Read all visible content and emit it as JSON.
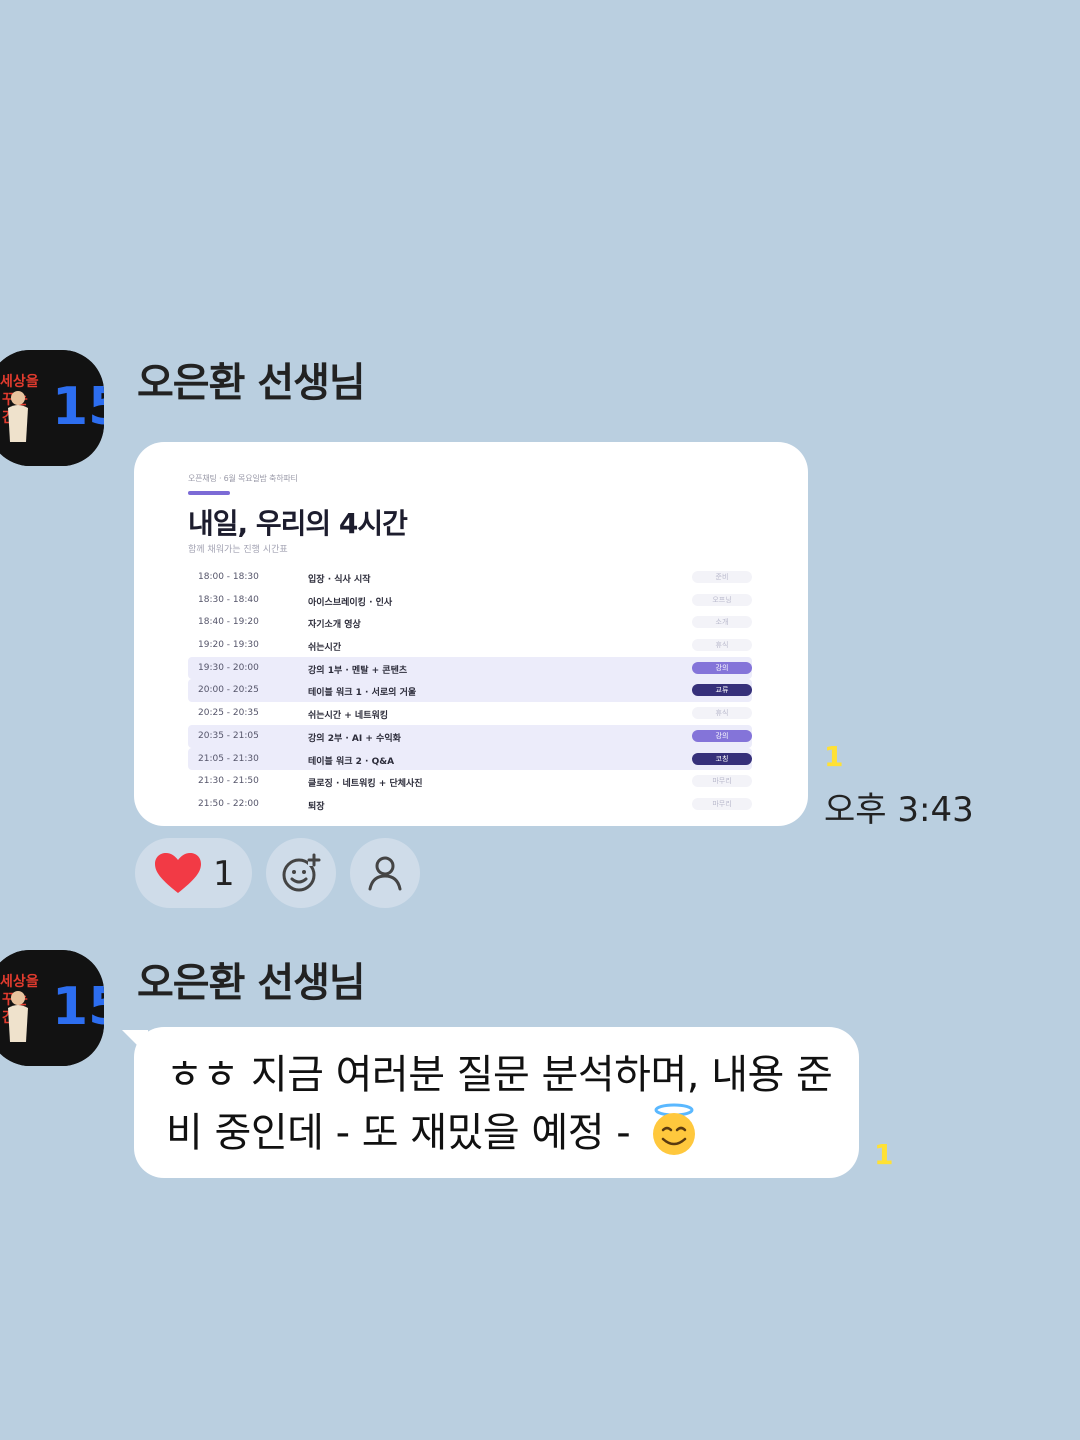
{
  "colors": {
    "background": "#bacfe0",
    "accent": "#7c6bd6",
    "read_count": "#ffe135",
    "heart": "#f23a45"
  },
  "messages": [
    {
      "sender": "오은환 선생님",
      "type": "image",
      "image": {
        "breadcrumb": "오픈채팅 · 6월 목요일밤 축하파티",
        "title": "내일, 우리의 4시간",
        "subtitle": "함께 채워가는 진행 시간표",
        "schedule": [
          {
            "time": "18:00 - 18:30",
            "activity": "입장 · 식사 시작",
            "tag": "준비",
            "kind": "plain",
            "highlight": false
          },
          {
            "time": "18:30 - 18:40",
            "activity": "아이스브레이킹 · 인사",
            "tag": "오프닝",
            "kind": "plain",
            "highlight": false
          },
          {
            "time": "18:40 - 19:20",
            "activity": "자기소개 영상",
            "tag": "소개",
            "kind": "plain",
            "highlight": false
          },
          {
            "time": "19:20 - 19:30",
            "activity": "쉬는시간",
            "tag": "휴식",
            "kind": "plain",
            "highlight": false
          },
          {
            "time": "19:30 - 20:00",
            "activity": "강의 1부 · 멘탈 + 콘텐츠",
            "tag": "강의",
            "kind": "main",
            "highlight": true
          },
          {
            "time": "20:00 - 20:25",
            "activity": "테이블 워크 1 · 서로의 거울",
            "tag": "교류",
            "kind": "dark",
            "highlight": true
          },
          {
            "time": "20:25 - 20:35",
            "activity": "쉬는시간 + 네트워킹",
            "tag": "휴식",
            "kind": "plain",
            "highlight": false
          },
          {
            "time": "20:35 - 21:05",
            "activity": "강의 2부 · AI + 수익화",
            "tag": "강의",
            "kind": "main",
            "highlight": true
          },
          {
            "time": "21:05 - 21:30",
            "activity": "테이블 워크 2 · Q&A",
            "tag": "코칭",
            "kind": "dark",
            "highlight": true
          },
          {
            "time": "21:30 - 21:50",
            "activity": "클로징 · 네트워킹 + 단체사진",
            "tag": "마무리",
            "kind": "plain",
            "highlight": false
          },
          {
            "time": "21:50 - 22:00",
            "activity": "퇴장",
            "tag": "마무리",
            "kind": "plain",
            "highlight": false
          }
        ]
      },
      "read_count": "1",
      "time": "오후 3:43",
      "reaction_count": "1"
    },
    {
      "sender": "오은환 선생님",
      "type": "text",
      "text": "ㅎㅎ 지금 여러분 질문 분석하며, 내용 준비 중인데 - 또 재밌을 예정 -",
      "read_count": "1"
    }
  ],
  "icons": {
    "avatar": "profile-image",
    "reaction": "heart-icon",
    "add_reaction": "add-emoji-icon",
    "profile": "person-icon",
    "emoji": "smiling-face-with-halo"
  }
}
